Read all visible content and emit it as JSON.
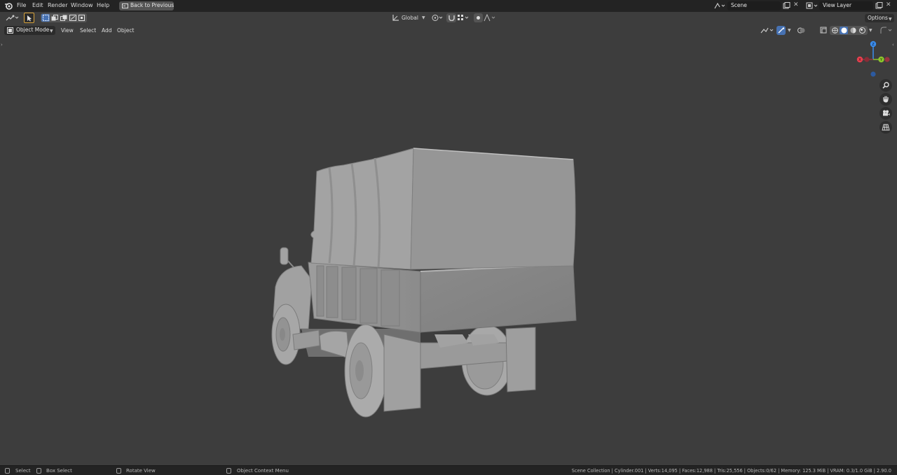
{
  "topbar": {
    "menus": [
      "File",
      "Edit",
      "Render",
      "Window",
      "Help"
    ],
    "back_button": "Back to Previous",
    "scene_name": "Scene",
    "view_layer": "View Layer"
  },
  "toolrow": {
    "orientation": "Global",
    "options_label": "Options"
  },
  "header": {
    "mode": "Object Mode",
    "menus": [
      "View",
      "Select",
      "Add",
      "Object"
    ]
  },
  "statusbar": {
    "select": "Select",
    "box_select": "Box Select",
    "rotate_view": "Rotate View",
    "context_menu": "Object Context Menu",
    "stats": "Scene Collection | Cylinder.001 | Verts:14,095 | Faces:12,988 | Tris:25,556 | Objects:0/62 | Memory: 125.3 MiB | VRAM: 0.3/1.0 GiB | 2.90.0"
  },
  "gizmo": {
    "z_label": "Z",
    "y_label": "Y",
    "x_label": "X",
    "colors": {
      "x": "#e8404f",
      "y": "#8bc42c",
      "z": "#3b8ff0",
      "neg": "#9a3440"
    }
  },
  "icons": [
    "blender-logo-icon",
    "select-cursor-icon",
    "zoom-icon",
    "pan-hand-icon",
    "camera-icon",
    "grid-icon",
    "scene-icon",
    "view-layer-icon"
  ]
}
